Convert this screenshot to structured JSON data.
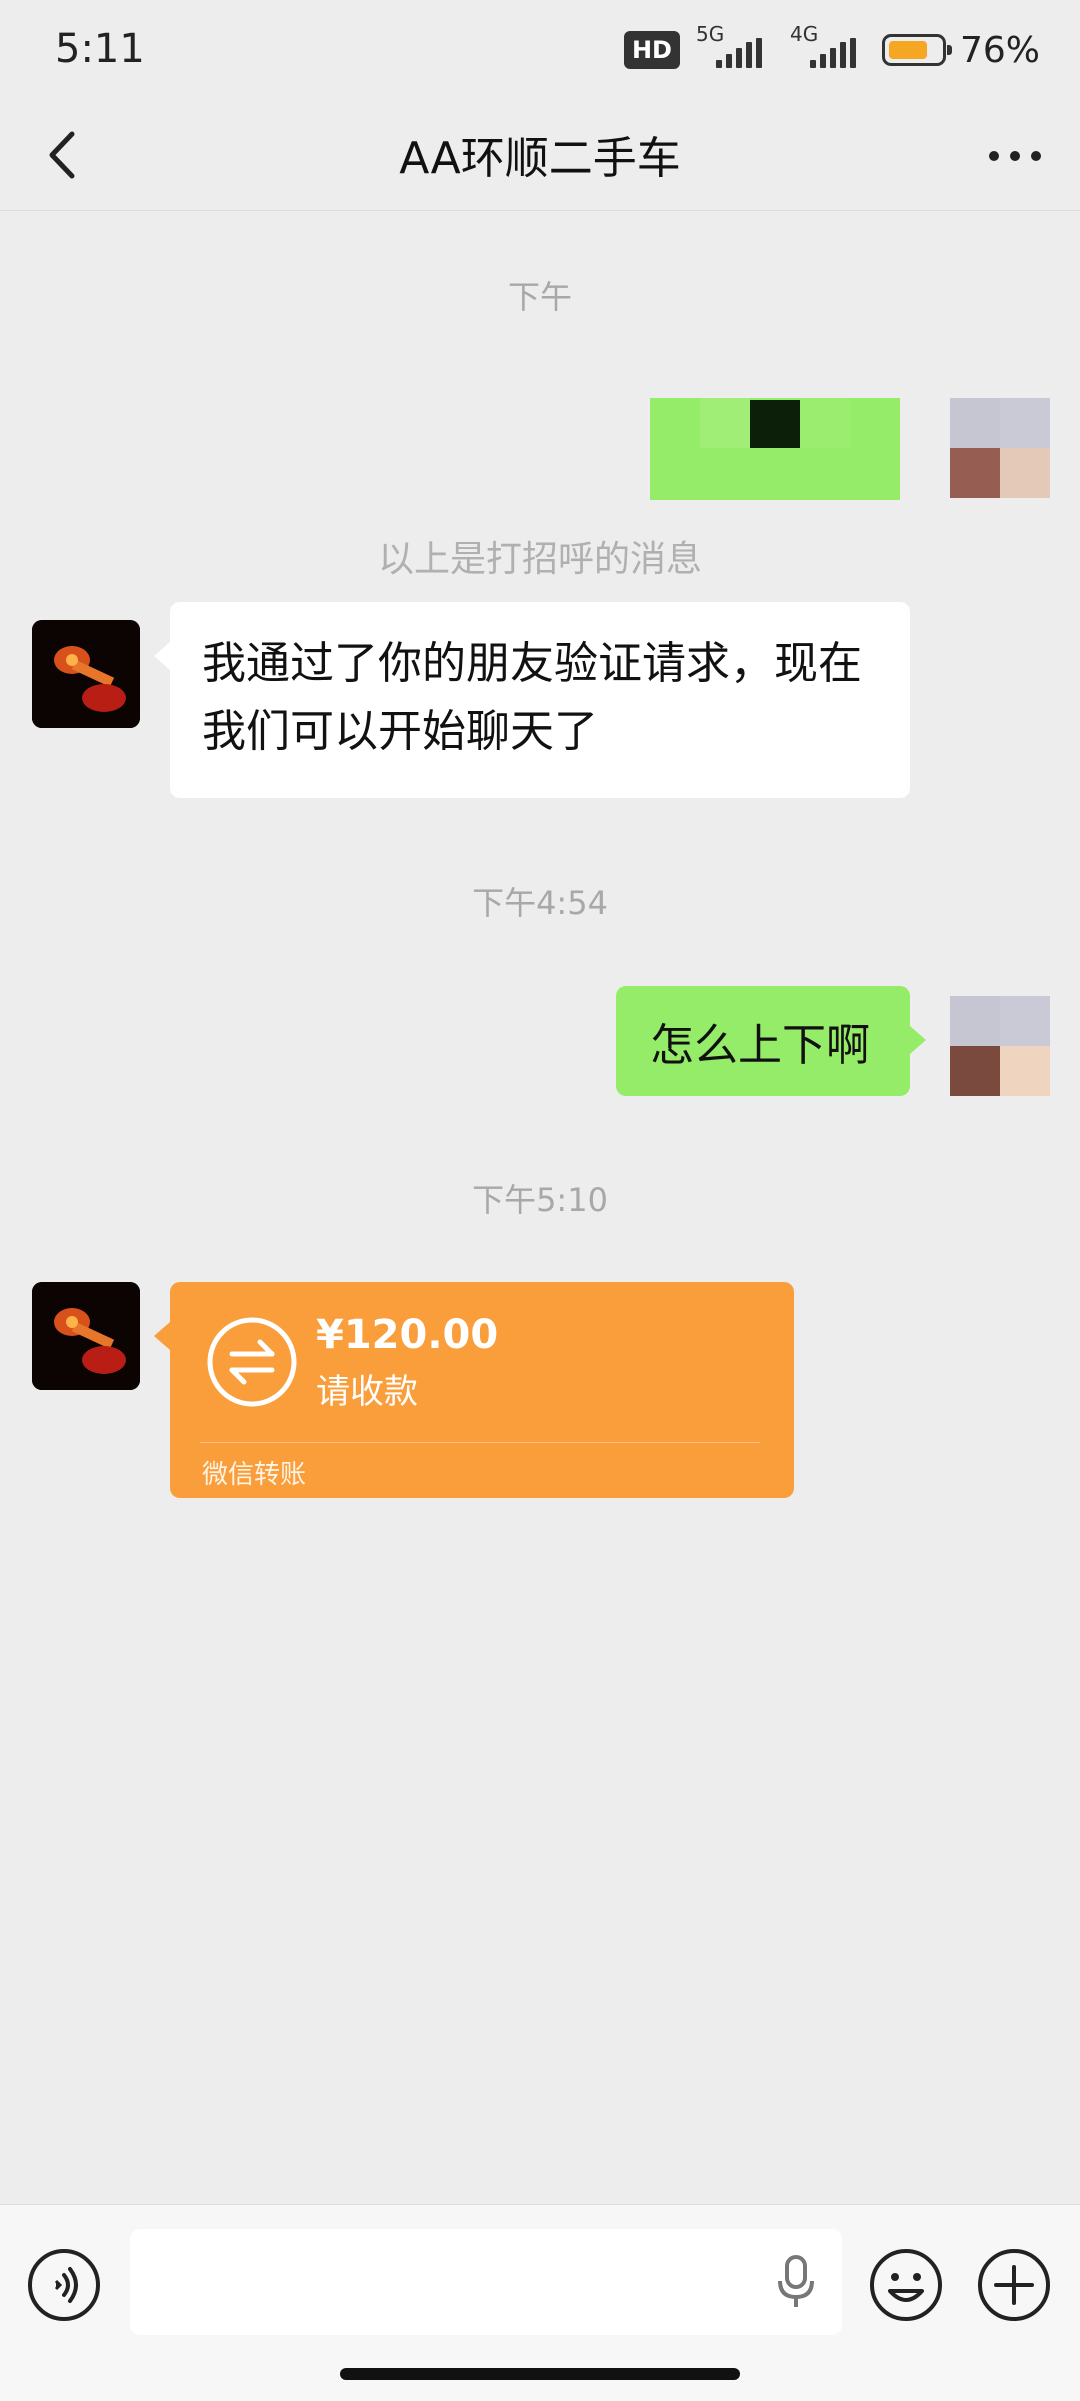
{
  "status_bar": {
    "time": "5:11",
    "hd_badge": "HD",
    "network_1": "5G",
    "network_2": "4G",
    "battery_percent": "76%",
    "battery_level": 0.76
  },
  "header": {
    "title": "AA环顺二手车",
    "back_icon": "chevron-left-icon",
    "more_icon": "more-dots-icon"
  },
  "messages": [
    {
      "type": "timestamp",
      "text": "下午"
    },
    {
      "type": "image",
      "side": "right"
    },
    {
      "type": "system",
      "text": "以上是打招呼的消息"
    },
    {
      "type": "text",
      "side": "left",
      "text": "我通过了你的朋友验证请求，现在我们可以开始聊天了"
    },
    {
      "type": "timestamp",
      "text": "下午4:54"
    },
    {
      "type": "text",
      "side": "right",
      "text": "怎么上下啊"
    },
    {
      "type": "timestamp",
      "text": "下午5:10"
    },
    {
      "type": "transfer",
      "side": "left",
      "amount": "¥120.00",
      "status": "请收款",
      "label": "微信转账"
    }
  ],
  "input_bar": {
    "voice_icon": "voice-toggle-icon",
    "mic_icon": "microphone-icon",
    "emoji_icon": "emoji-icon",
    "plus_icon": "plus-icon"
  },
  "colors": {
    "background": "#ededed",
    "bubble_self": "#95ec69",
    "bubble_other": "#ffffff",
    "transfer": "#fa9d3b"
  }
}
